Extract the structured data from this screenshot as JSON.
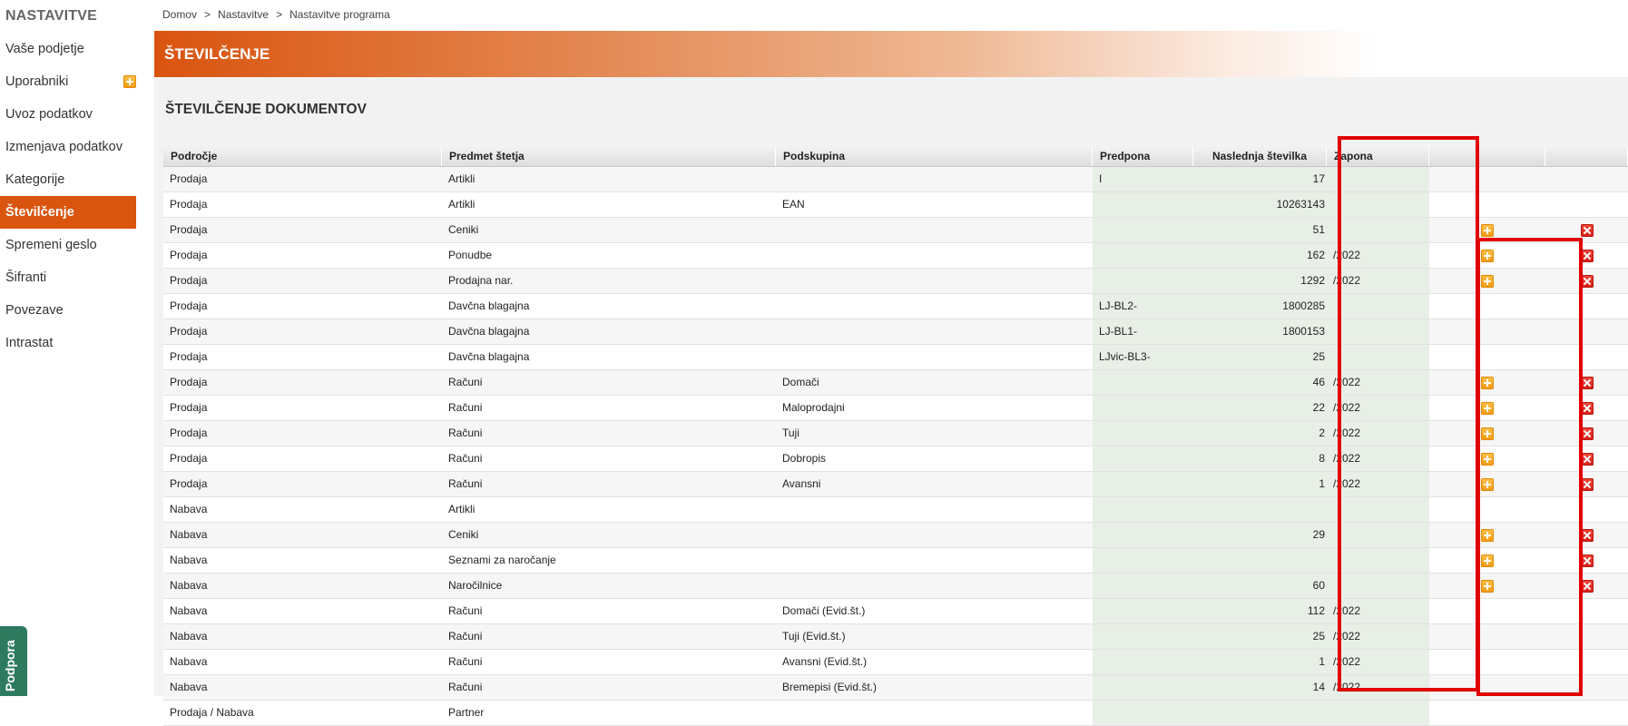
{
  "sidebar": {
    "title": "NASTAVITVE",
    "items": [
      {
        "label": "Vaše podjetje"
      },
      {
        "label": "Uporabniki"
      },
      {
        "label": "Uvoz podatkov"
      },
      {
        "label": "Izmenjava podatkov"
      },
      {
        "label": "Kategorije"
      },
      {
        "label": "Številčenje"
      },
      {
        "label": "Spremeni geslo"
      },
      {
        "label": "Šifranti"
      },
      {
        "label": "Povezave"
      },
      {
        "label": "Intrastat"
      }
    ],
    "active_item": "Številčenje",
    "support_label": "Podpora"
  },
  "breadcrumb": {
    "items": [
      "Domov",
      "Nastavitve",
      "Nastavitve programa"
    ],
    "separator": ">"
  },
  "header": {
    "title": "ŠTEVILČENJE"
  },
  "section": {
    "title": "ŠTEVILČENJE DOKUMENTOV"
  },
  "table": {
    "columns": [
      "Področje",
      "Predmet štetja",
      "Podskupina",
      "Predpona",
      "Naslednja številka",
      "Zapona",
      "",
      ""
    ],
    "rows": [
      {
        "area": "Prodaja",
        "subject": "Artikli",
        "subgroup": "",
        "prefix": "I",
        "next": "17",
        "suffix": "",
        "add": false,
        "del": false
      },
      {
        "area": "Prodaja",
        "subject": "Artikli",
        "subgroup": "EAN",
        "prefix": "",
        "next": "10263143",
        "suffix": "",
        "add": false,
        "del": false
      },
      {
        "area": "Prodaja",
        "subject": "Ceniki",
        "subgroup": "",
        "prefix": "",
        "next": "51",
        "suffix": "",
        "add": true,
        "del": true
      },
      {
        "area": "Prodaja",
        "subject": "Ponudbe",
        "subgroup": "",
        "prefix": "",
        "next": "162",
        "suffix": "/2022",
        "add": true,
        "del": true
      },
      {
        "area": "Prodaja",
        "subject": "Prodajna nar.",
        "subgroup": "",
        "prefix": "",
        "next": "1292",
        "suffix": "/2022",
        "add": true,
        "del": true
      },
      {
        "area": "Prodaja",
        "subject": "Davčna blagajna",
        "subgroup": "",
        "prefix": "LJ-BL2-",
        "next": "1800285",
        "suffix": "",
        "add": false,
        "del": false
      },
      {
        "area": "Prodaja",
        "subject": "Davčna blagajna",
        "subgroup": "",
        "prefix": "LJ-BL1-",
        "next": "1800153",
        "suffix": "",
        "add": false,
        "del": false
      },
      {
        "area": "Prodaja",
        "subject": "Davčna blagajna",
        "subgroup": "",
        "prefix": "LJvic-BL3-",
        "next": "25",
        "suffix": "",
        "add": false,
        "del": false
      },
      {
        "area": "Prodaja",
        "subject": "Računi",
        "subgroup": "Domači",
        "prefix": "",
        "next": "46",
        "suffix": "/2022",
        "add": true,
        "del": true
      },
      {
        "area": "Prodaja",
        "subject": "Računi",
        "subgroup": "Maloprodajni",
        "prefix": "",
        "next": "22",
        "suffix": "/2022",
        "add": true,
        "del": true
      },
      {
        "area": "Prodaja",
        "subject": "Računi",
        "subgroup": "Tuji",
        "prefix": "",
        "next": "2",
        "suffix": "/2022",
        "add": true,
        "del": true
      },
      {
        "area": "Prodaja",
        "subject": "Računi",
        "subgroup": "Dobropis",
        "prefix": "",
        "next": "8",
        "suffix": "/2022",
        "add": true,
        "del": true
      },
      {
        "area": "Prodaja",
        "subject": "Računi",
        "subgroup": "Avansni",
        "prefix": "",
        "next": "1",
        "suffix": "/2022",
        "add": true,
        "del": true
      },
      {
        "area": "Nabava",
        "subject": "Artikli",
        "subgroup": "",
        "prefix": "",
        "next": "",
        "suffix": "",
        "add": false,
        "del": false
      },
      {
        "area": "Nabava",
        "subject": "Ceniki",
        "subgroup": "",
        "prefix": "",
        "next": "29",
        "suffix": "",
        "add": true,
        "del": true
      },
      {
        "area": "Nabava",
        "subject": "Seznami za naročanje",
        "subgroup": "",
        "prefix": "",
        "next": "",
        "suffix": "",
        "add": true,
        "del": true
      },
      {
        "area": "Nabava",
        "subject": "Naročilnice",
        "subgroup": "",
        "prefix": "",
        "next": "60",
        "suffix": "",
        "add": true,
        "del": true
      },
      {
        "area": "Nabava",
        "subject": "Računi",
        "subgroup": "Domači (Evid.št.)",
        "prefix": "",
        "next": "112",
        "suffix": "/2022",
        "add": false,
        "del": false
      },
      {
        "area": "Nabava",
        "subject": "Računi",
        "subgroup": "Tuji (Evid.št.)",
        "prefix": "",
        "next": "25",
        "suffix": "/2022",
        "add": false,
        "del": false
      },
      {
        "area": "Nabava",
        "subject": "Računi",
        "subgroup": "Avansni (Evid.št.)",
        "prefix": "",
        "next": "1",
        "suffix": "/2022",
        "add": false,
        "del": false
      },
      {
        "area": "Nabava",
        "subject": "Računi",
        "subgroup": "Bremepisi (Evid.št.)",
        "prefix": "",
        "next": "14",
        "suffix": "/2022",
        "add": false,
        "del": false
      },
      {
        "area": "Prodaja / Nabava",
        "subject": "Partner",
        "subgroup": "",
        "prefix": "",
        "next": "",
        "suffix": "",
        "add": false,
        "del": false
      }
    ]
  },
  "colors": {
    "accent": "#d9540f",
    "highlight": "#e00000",
    "editable_cell": "#e8efe6",
    "support_tab": "#2d7a5f"
  },
  "icons": {
    "add": "plus-icon",
    "delete": "x-icon"
  }
}
